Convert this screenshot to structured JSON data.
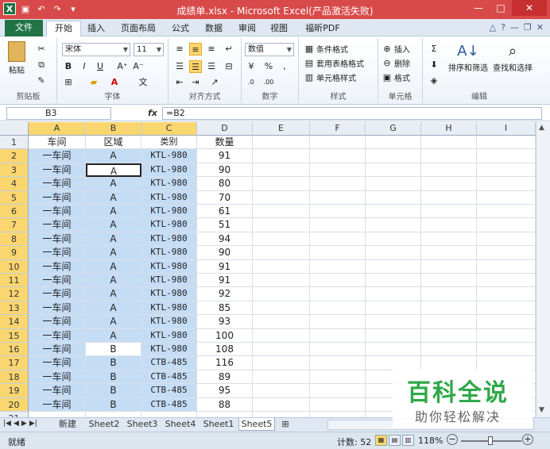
{
  "window": {
    "title": "成绩单.xlsx - Microsoft Excel(产品激活失败)",
    "logo": "X",
    "quick_access": [
      "save-icon",
      "undo-icon",
      "redo-icon",
      "customize-icon"
    ],
    "controls": [
      "—",
      "□",
      "✕"
    ]
  },
  "ribbon_tabs": [
    "开始",
    "插入",
    "页面布局",
    "公式",
    "数据",
    "审阅",
    "视图",
    "福昕PDF"
  ],
  "file_tab": "文件",
  "active_tab": "开始",
  "ribbon": {
    "clipboard": {
      "label": "剪贴板",
      "paste": "粘贴"
    },
    "font": {
      "label": "字体",
      "name": "宋体",
      "size": "11",
      "bold": "B",
      "italic": "I",
      "underline": "U"
    },
    "alignment": {
      "label": "对齐方式"
    },
    "number": {
      "label": "数字",
      "format": "数值"
    },
    "styles": {
      "label": "样式",
      "conditional": "条件格式",
      "table": "套用表格格式",
      "cell": "单元格样式"
    },
    "cells": {
      "label": "单元格",
      "insert": "插入",
      "delete": "删除",
      "format": "格式"
    },
    "editing": {
      "label": "编辑",
      "sort": "排序和筛选",
      "find": "查找和选择"
    }
  },
  "formula_bar": {
    "name_box": "B3",
    "fx": "fx",
    "formula": "=B2"
  },
  "columns": [
    "A",
    "B",
    "C",
    "D",
    "E",
    "F",
    "G",
    "H",
    "I"
  ],
  "rows": [
    [
      "1",
      "车间",
      "区域",
      "类别",
      "数量"
    ],
    [
      "2",
      "一车间",
      "A",
      "KTL-980",
      "91"
    ],
    [
      "3",
      "一车间",
      "A",
      "KTL-980",
      "90"
    ],
    [
      "4",
      "一车间",
      "A",
      "KTL-980",
      "80"
    ],
    [
      "5",
      "一车间",
      "A",
      "KTL-980",
      "70"
    ],
    [
      "6",
      "一车间",
      "A",
      "KTL-980",
      "61"
    ],
    [
      "7",
      "一车间",
      "A",
      "KTL-980",
      "51"
    ],
    [
      "8",
      "一车间",
      "A",
      "KTL-980",
      "94"
    ],
    [
      "9",
      "一车间",
      "A",
      "KTL-980",
      "90"
    ],
    [
      "10",
      "一车间",
      "A",
      "KTL-980",
      "91"
    ],
    [
      "11",
      "一车间",
      "A",
      "KTL-980",
      "91"
    ],
    [
      "12",
      "一车间",
      "A",
      "KTL-980",
      "92"
    ],
    [
      "13",
      "一车间",
      "A",
      "KTL-980",
      "85"
    ],
    [
      "14",
      "一车间",
      "A",
      "KTL-980",
      "93"
    ],
    [
      "15",
      "一车间",
      "A",
      "KTL-980",
      "100"
    ],
    [
      "16",
      "一车间",
      "B",
      "KTL-980",
      "108"
    ],
    [
      "17",
      "一车间",
      "B",
      "CTB-485",
      "116"
    ],
    [
      "18",
      "一车间",
      "B",
      "CTB-485",
      "89"
    ],
    [
      "19",
      "一车间",
      "B",
      "CTB-485",
      "95"
    ],
    [
      "20",
      "一车间",
      "B",
      "CTB-485",
      "88"
    ],
    [
      "21",
      "",
      "",
      "",
      ""
    ]
  ],
  "sheets": [
    "新建",
    "Sheet2",
    "Sheet3",
    "Sheet4",
    "Sheet1",
    "Sheet5"
  ],
  "active_sheet": "Sheet5",
  "status": {
    "mode": "就绪",
    "count": "计数: 52",
    "zoom": "118%"
  },
  "watermark": {
    "title": "百科全说",
    "subtitle": "助你轻松解决"
  },
  "colors": {
    "titlebar": "#d84a4a",
    "selection": "#c5dcf5",
    "header_highlight": "#f9d66f",
    "file_tab": "#217346"
  }
}
